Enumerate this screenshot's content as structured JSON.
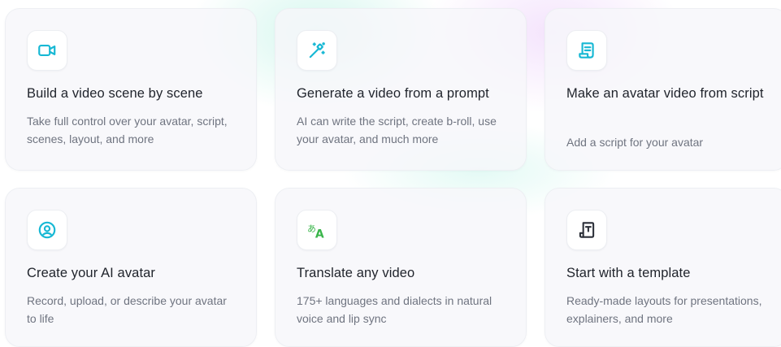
{
  "colors": {
    "icon_teal": "#17b8d4",
    "icon_green": "#39b54a",
    "icon_dark": "#2b2f38",
    "title_text": "#1f232b",
    "desc_text": "#6f7480",
    "card_bg": "#f6f7fa"
  },
  "cards": [
    {
      "icon": "video-camera-icon",
      "title": "Build a video scene by scene",
      "description": "Take full control over your avatar, script, scenes, layout, and more"
    },
    {
      "icon": "magic-wand-icon",
      "title": "Generate a video from a prompt",
      "description": "AI can write the script, create b-roll, use your avatar, and much more"
    },
    {
      "icon": "script-document-icon",
      "title": "Make an avatar video from script",
      "description": "Add a script for your avatar"
    },
    {
      "icon": "avatar-person-icon",
      "title": "Create your AI avatar",
      "description": "Record, upload, or describe your avatar to life"
    },
    {
      "icon": "translate-icon",
      "title": "Translate any video",
      "description": "175+ languages and dialects in natural voice and lip sync"
    },
    {
      "icon": "template-icon",
      "title": "Start with a template",
      "description": "Ready-made layouts for presentations, explainers, and more"
    }
  ]
}
